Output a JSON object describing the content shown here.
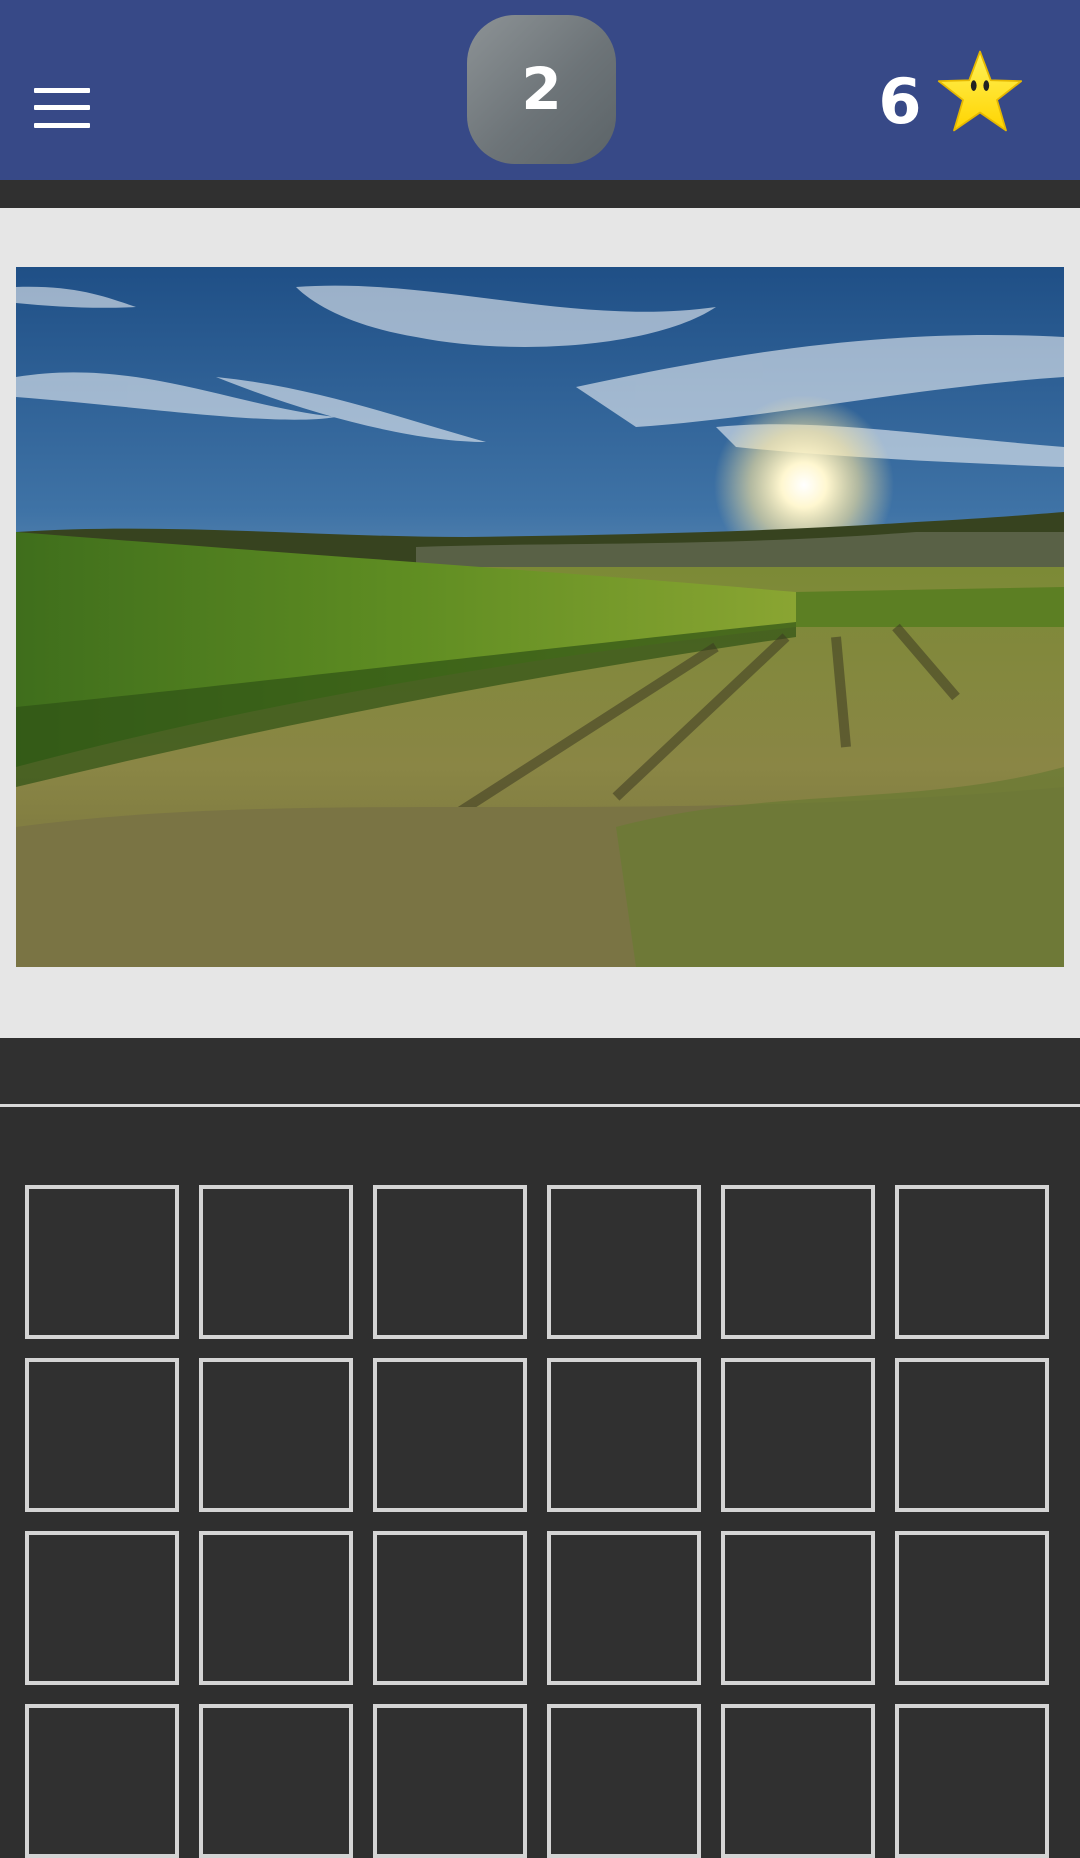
{
  "header": {
    "menu_icon": "hamburger-menu-icon",
    "level": "2",
    "coins": "6",
    "coin_icon": "star-icon",
    "bar_color": "#374987"
  },
  "puzzle": {
    "image_icon": "vineyard-sunset-photo"
  },
  "letters": {
    "tiles": [
      "",
      "",
      "",
      "",
      "",
      "",
      "",
      "",
      "",
      "",
      "",
      "",
      "",
      "",
      "",
      "",
      "",
      "",
      "",
      "",
      "",
      "",
      "",
      ""
    ]
  },
  "colors": {
    "panel": "#e6e6e6",
    "background": "#2f2f2f",
    "tile_border": "#d4d4d4",
    "star": "#ffe600"
  }
}
